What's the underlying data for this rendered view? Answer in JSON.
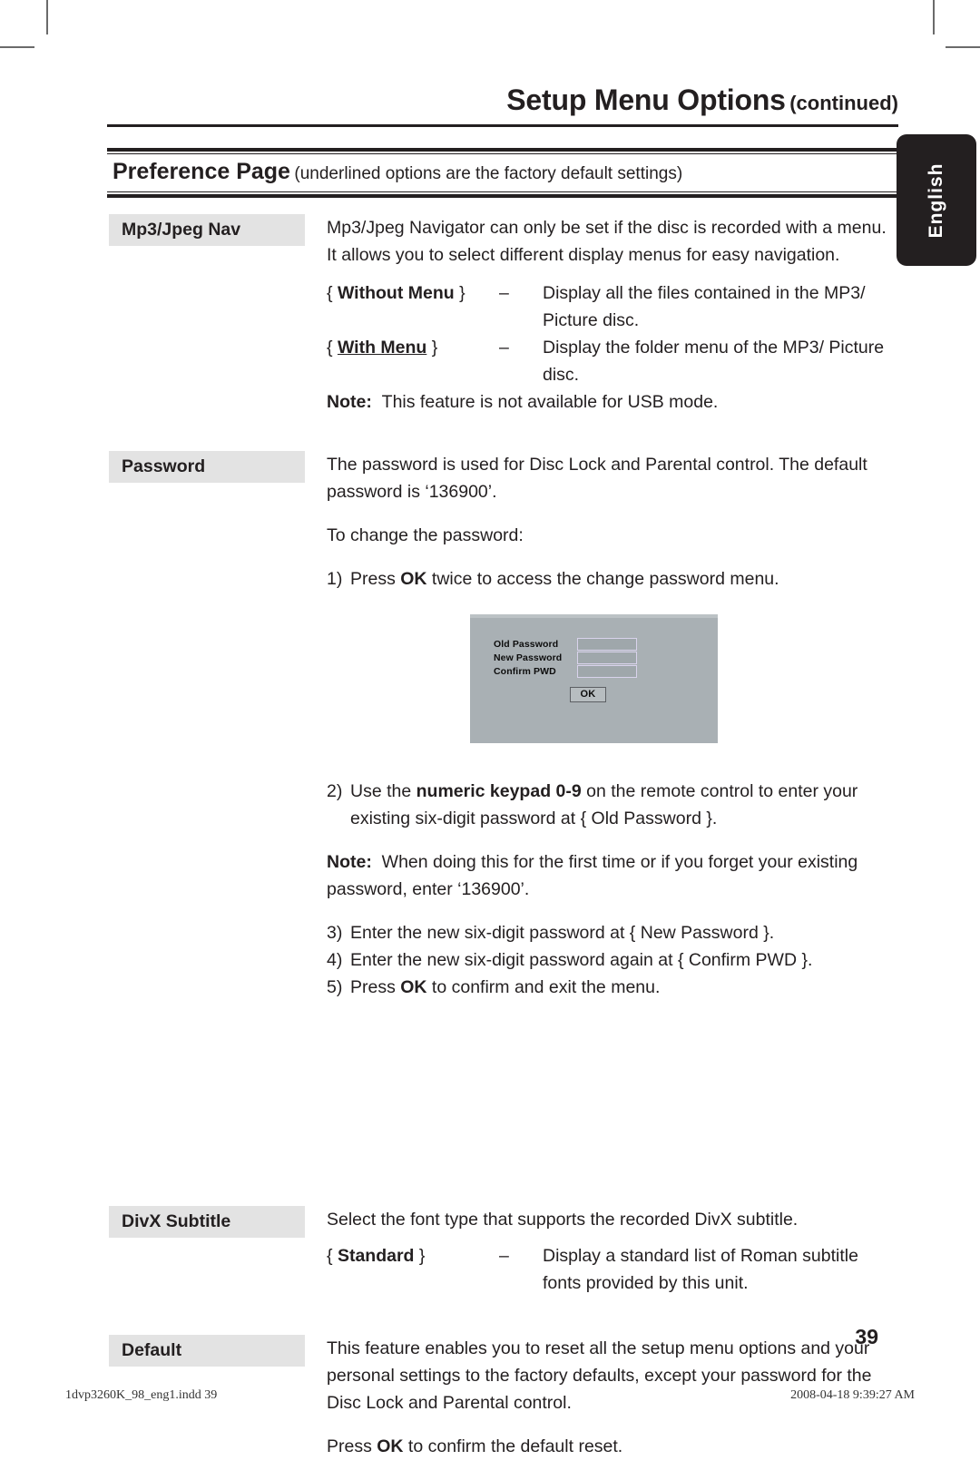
{
  "header": {
    "title": "Setup Menu Options",
    "continued": "(continued)"
  },
  "banner": {
    "title": "Preference Page",
    "subtitle": "(underlined options are the factory default settings)"
  },
  "language_tab": {
    "label": "English"
  },
  "sections": {
    "mp3": {
      "label": "Mp3/Jpeg Nav",
      "intro": "Mp3/Jpeg Navigator can only be set if the disc is recorded with a menu. It allows you to select different display menus for easy navigation.",
      "options": [
        {
          "open": "{",
          "name": "Without Menu",
          "close": "}",
          "dash": "–",
          "desc": "Display all the files contained in the MP3/ Picture disc.",
          "underlined": false
        },
        {
          "open": "{",
          "name": "With Menu",
          "close": "}",
          "dash": "–",
          "desc": "Display the folder menu of the MP3/ Picture disc.",
          "underlined": true
        }
      ],
      "note_label": "Note:",
      "note_text": "This feature is not available for USB mode."
    },
    "password": {
      "label": "Password",
      "intro": "The password is used for Disc Lock and Parental control. The default password is ‘136900’.",
      "to_change": "To change the password:",
      "step1_idx": "1)",
      "step1_a": "Press ",
      "step1_b": "OK",
      "step1_c": " twice to access the change password menu.",
      "step2_idx": "2)",
      "step2_a": "Use the ",
      "step2_b": "numeric keypad 0-9",
      "step2_c": " on the remote control to enter your existing six-digit password at { Old Password }.",
      "note_label": "Note:",
      "note_text": "When doing this for the first time or if you forget your existing password, enter ‘136900’.",
      "step3_idx": "3)",
      "step3_text": "Enter the new six-digit password at { New Password }.",
      "step4_idx": "4)",
      "step4_text": "Enter the new six-digit password again at { Confirm PWD }.",
      "step5_idx": "5)",
      "step5_a": "Press ",
      "step5_b": "OK",
      "step5_c": " to confirm and exit the menu."
    },
    "divx": {
      "label": "DivX Subtitle",
      "intro": "Select the font type that supports the recorded DivX subtitle.",
      "options": [
        {
          "open": "{",
          "name": "Standard",
          "close": "}",
          "dash": "–",
          "desc": "Display a standard list of Roman subtitle fonts provided by this unit.",
          "underlined": false
        }
      ]
    },
    "default": {
      "label": "Default",
      "intro": "This feature enables you to reset all the setup menu options and your personal settings to the factory defaults, except your password for the Disc Lock and Parental control.",
      "press_a": "Press ",
      "press_b": "OK",
      "press_c": " to confirm the default reset."
    }
  },
  "osd_dialog": {
    "field_old": "Old  Password",
    "field_new": "New Password",
    "field_confirm": "Confirm PWD",
    "ok_button": "OK",
    "background_color": "#a9b0b4"
  },
  "page_number": "39",
  "footer": {
    "file": "1dvp3260K_98_eng1.indd   39",
    "timestamp": "2008-04-18   9:39:27 AM"
  }
}
